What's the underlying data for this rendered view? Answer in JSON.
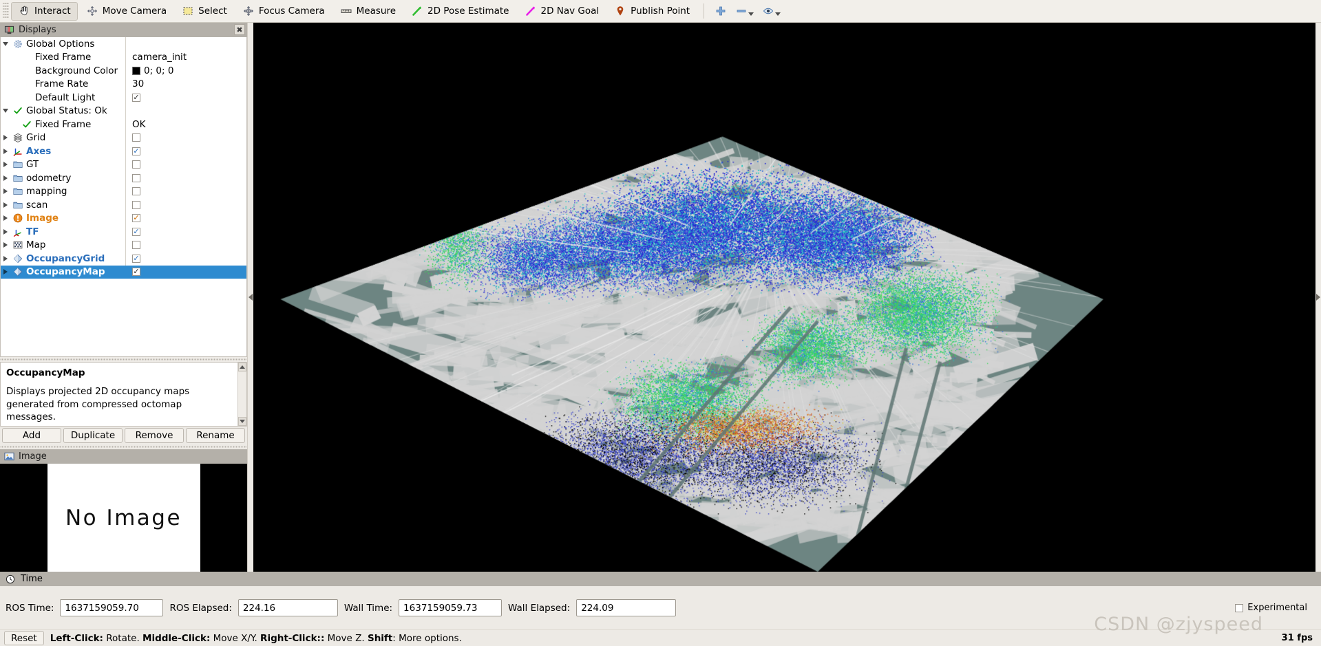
{
  "toolbar": {
    "tools": [
      {
        "label": "Interact",
        "icon": "hand-cursor-icon",
        "active": true
      },
      {
        "label": "Move Camera",
        "icon": "move-camera-icon",
        "active": false
      },
      {
        "label": "Select",
        "icon": "select-rect-icon",
        "active": false
      },
      {
        "label": "Focus Camera",
        "icon": "focus-camera-icon",
        "active": false
      },
      {
        "label": "Measure",
        "icon": "ruler-icon",
        "active": false
      },
      {
        "label": "2D Pose Estimate",
        "icon": "green-arrow-icon",
        "active": false
      },
      {
        "label": "2D Nav Goal",
        "icon": "magenta-arrow-icon",
        "active": false
      },
      {
        "label": "Publish Point",
        "icon": "map-pin-icon",
        "active": false
      }
    ],
    "extra_icons": [
      "plus-icon",
      "minus-icon",
      "eye-icon"
    ]
  },
  "displays_panel": {
    "title": "Displays",
    "close_label": "✖",
    "tree": [
      {
        "indent": 0,
        "arrow": "open",
        "icon": "gear-icon",
        "label": "Global Options",
        "style": "normal",
        "value_type": "none"
      },
      {
        "indent": 2,
        "arrow": "none",
        "icon": "none",
        "label": "Fixed Frame",
        "style": "normal",
        "value_type": "text",
        "value": "camera_init"
      },
      {
        "indent": 2,
        "arrow": "none",
        "icon": "none",
        "label": "Background Color",
        "style": "normal",
        "value_type": "color",
        "value": "0; 0; 0",
        "color": "#000000"
      },
      {
        "indent": 2,
        "arrow": "none",
        "icon": "none",
        "label": "Frame Rate",
        "style": "normal",
        "value_type": "text",
        "value": "30"
      },
      {
        "indent": 2,
        "arrow": "none",
        "icon": "none",
        "label": "Default Light",
        "style": "normal",
        "value_type": "check",
        "checked": true
      },
      {
        "indent": 0,
        "arrow": "open",
        "icon": "green-check-icon",
        "label": "Global Status: Ok",
        "style": "normal",
        "value_type": "none"
      },
      {
        "indent": 2,
        "arrow": "none",
        "icon": "green-check-icon",
        "label": "Fixed Frame",
        "style": "normal",
        "value_type": "text",
        "value": "OK"
      },
      {
        "indent": 0,
        "arrow": "closed",
        "icon": "grid-icon",
        "label": "Grid",
        "style": "normal",
        "value_type": "check",
        "checked": false
      },
      {
        "indent": 0,
        "arrow": "closed",
        "icon": "axes-icon",
        "label": "Axes",
        "style": "blue",
        "value_type": "check",
        "checked": true
      },
      {
        "indent": 0,
        "arrow": "closed",
        "icon": "folder-icon",
        "label": "GT",
        "style": "normal",
        "value_type": "check",
        "checked": false
      },
      {
        "indent": 0,
        "arrow": "closed",
        "icon": "folder-icon",
        "label": "odometry",
        "style": "normal",
        "value_type": "check",
        "checked": false
      },
      {
        "indent": 0,
        "arrow": "closed",
        "icon": "folder-icon",
        "label": "mapping",
        "style": "normal",
        "value_type": "check",
        "checked": false
      },
      {
        "indent": 0,
        "arrow": "closed",
        "icon": "folder-icon",
        "label": "scan",
        "style": "normal",
        "value_type": "check",
        "checked": false
      },
      {
        "indent": 0,
        "arrow": "closed",
        "icon": "warning-icon",
        "label": "Image",
        "style": "orange",
        "value_type": "check",
        "checked": true
      },
      {
        "indent": 0,
        "arrow": "closed",
        "icon": "tf-icon",
        "label": "TF",
        "style": "blue",
        "value_type": "check",
        "checked": true
      },
      {
        "indent": 0,
        "arrow": "closed",
        "icon": "map-grid-icon",
        "label": "Map",
        "style": "normal",
        "value_type": "check",
        "checked": false
      },
      {
        "indent": 0,
        "arrow": "closed",
        "icon": "diamond-icon",
        "label": "OccupancyGrid",
        "style": "blue",
        "value_type": "check",
        "checked": true
      },
      {
        "indent": 0,
        "arrow": "closed",
        "icon": "diamond-icon",
        "label": "OccupancyMap",
        "style": "blue",
        "value_type": "check",
        "checked": true,
        "selected": true
      }
    ],
    "description": {
      "title": "OccupancyMap",
      "body": "Displays projected 2D occupancy maps generated from compressed octomap messages."
    },
    "buttons": [
      "Add",
      "Duplicate",
      "Remove",
      "Rename"
    ]
  },
  "image_panel": {
    "title": "Image",
    "placeholder": "No Image"
  },
  "time_panel": {
    "title": "Time",
    "fields": [
      {
        "label": "ROS Time:",
        "value": "1637159059.70"
      },
      {
        "label": "ROS Elapsed:",
        "value": "224.16"
      },
      {
        "label": "Wall Time:",
        "value": "1637159059.73"
      },
      {
        "label": "Wall Elapsed:",
        "value": "224.09"
      }
    ],
    "experimental_label": "Experimental",
    "experimental_checked": false
  },
  "status_bar": {
    "reset_label": "Reset",
    "hints": [
      {
        "key": "Left-Click:",
        "text": " Rotate."
      },
      {
        "key": "Middle-Click:",
        "text": " Move X/Y."
      },
      {
        "key": "Right-Click::",
        "text": " Move Z."
      },
      {
        "key": "Shift",
        "text": ": More options."
      }
    ],
    "fps": "31 fps"
  },
  "watermark": "CSDN @zjyspeed",
  "viewport": {
    "background": "#000000",
    "ground_color": "#6d8582",
    "occupancy_color": "#d3d3d3"
  }
}
